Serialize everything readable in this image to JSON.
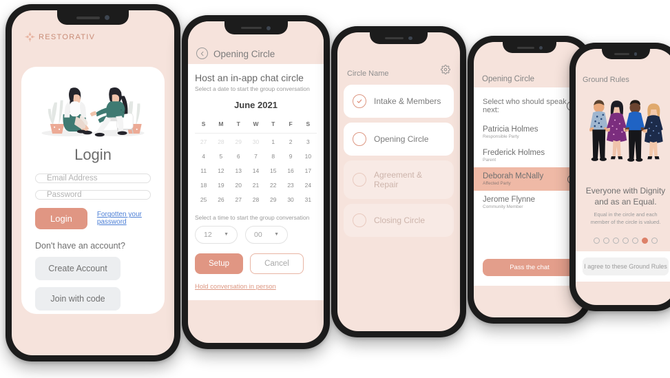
{
  "brand": {
    "name": "RESTORATIV",
    "accent": "#e09683",
    "screen_bg": "#f6e3dc",
    "link_blue": "#4c7fd6"
  },
  "phone1": {
    "title": "Login",
    "email_placeholder": "Email Address",
    "password_placeholder": "Password",
    "login_button": "Login",
    "forgot_link": "Forgotten your password",
    "no_account_text": "Don't have an account?",
    "create_account_button": "Create Account",
    "join_code_button": "Join with code"
  },
  "phone2": {
    "header_title": "Opening Circle",
    "heading": "Host an in-app chat circle",
    "subheading": "Select a date to start the group conversation",
    "month": "June 2021",
    "dow": [
      "S",
      "M",
      "T",
      "W",
      "T",
      "F",
      "S"
    ],
    "weeks": [
      [
        {
          "d": "27",
          "m": true
        },
        {
          "d": "28",
          "m": true
        },
        {
          "d": "29",
          "m": true
        },
        {
          "d": "30",
          "m": true
        },
        {
          "d": "1",
          "m": false
        },
        {
          "d": "2",
          "m": false
        },
        {
          "d": "3",
          "m": false
        }
      ],
      [
        {
          "d": "4",
          "m": false
        },
        {
          "d": "5",
          "m": false
        },
        {
          "d": "6",
          "m": false
        },
        {
          "d": "7",
          "m": false
        },
        {
          "d": "8",
          "m": false
        },
        {
          "d": "9",
          "m": false
        },
        {
          "d": "10",
          "m": false
        }
      ],
      [
        {
          "d": "11",
          "m": false
        },
        {
          "d": "12",
          "m": false
        },
        {
          "d": "13",
          "m": false
        },
        {
          "d": "14",
          "m": false
        },
        {
          "d": "15",
          "m": false
        },
        {
          "d": "16",
          "m": false
        },
        {
          "d": "17",
          "m": false
        }
      ],
      [
        {
          "d": "18",
          "m": false
        },
        {
          "d": "19",
          "m": false
        },
        {
          "d": "20",
          "m": false
        },
        {
          "d": "21",
          "m": false
        },
        {
          "d": "22",
          "m": false
        },
        {
          "d": "23",
          "m": false
        },
        {
          "d": "24",
          "m": false
        }
      ],
      [
        {
          "d": "25",
          "m": false
        },
        {
          "d": "26",
          "m": false
        },
        {
          "d": "27",
          "m": false
        },
        {
          "d": "28",
          "m": false
        },
        {
          "d": "29",
          "m": false
        },
        {
          "d": "30",
          "m": false
        },
        {
          "d": "31",
          "m": false
        }
      ]
    ],
    "time_label": "Select a time to start the group conversation",
    "hour_value": "12",
    "minute_value": "00",
    "setup_button": "Setup",
    "cancel_button": "Cancel",
    "in_person_link": "Hold conversation in person"
  },
  "phone3": {
    "title": "Circle Name",
    "steps": [
      {
        "label": "Intake & Members",
        "state": "done"
      },
      {
        "label": "Opening Circle",
        "state": "current"
      },
      {
        "label": "Agreement & Repair",
        "state": "disabled"
      },
      {
        "label": "Closing Circle",
        "state": "disabled"
      }
    ]
  },
  "phone4": {
    "header_title": "Opening Circle",
    "prompt": "Select who should speak next:",
    "members": [
      {
        "name": "Patricia Holmes",
        "role": "Responsible Party",
        "selected": false
      },
      {
        "name": "Frederick Holmes",
        "role": "Parent",
        "selected": false
      },
      {
        "name": "Deborah McNally",
        "role": "Affected Party",
        "selected": true
      },
      {
        "name": "Jerome Flynne",
        "role": "Community Member",
        "selected": false
      }
    ],
    "pass_button": "Pass the chat"
  },
  "phone5": {
    "header_title": "Ground Rules",
    "heading": "Everyone with Dignity and as an Equal.",
    "paragraph": "Equal in the circle and each member of the circle is valued.",
    "dots_total": 7,
    "dots_active_index": 5,
    "agree_button": "I agree to these Ground Rules"
  }
}
